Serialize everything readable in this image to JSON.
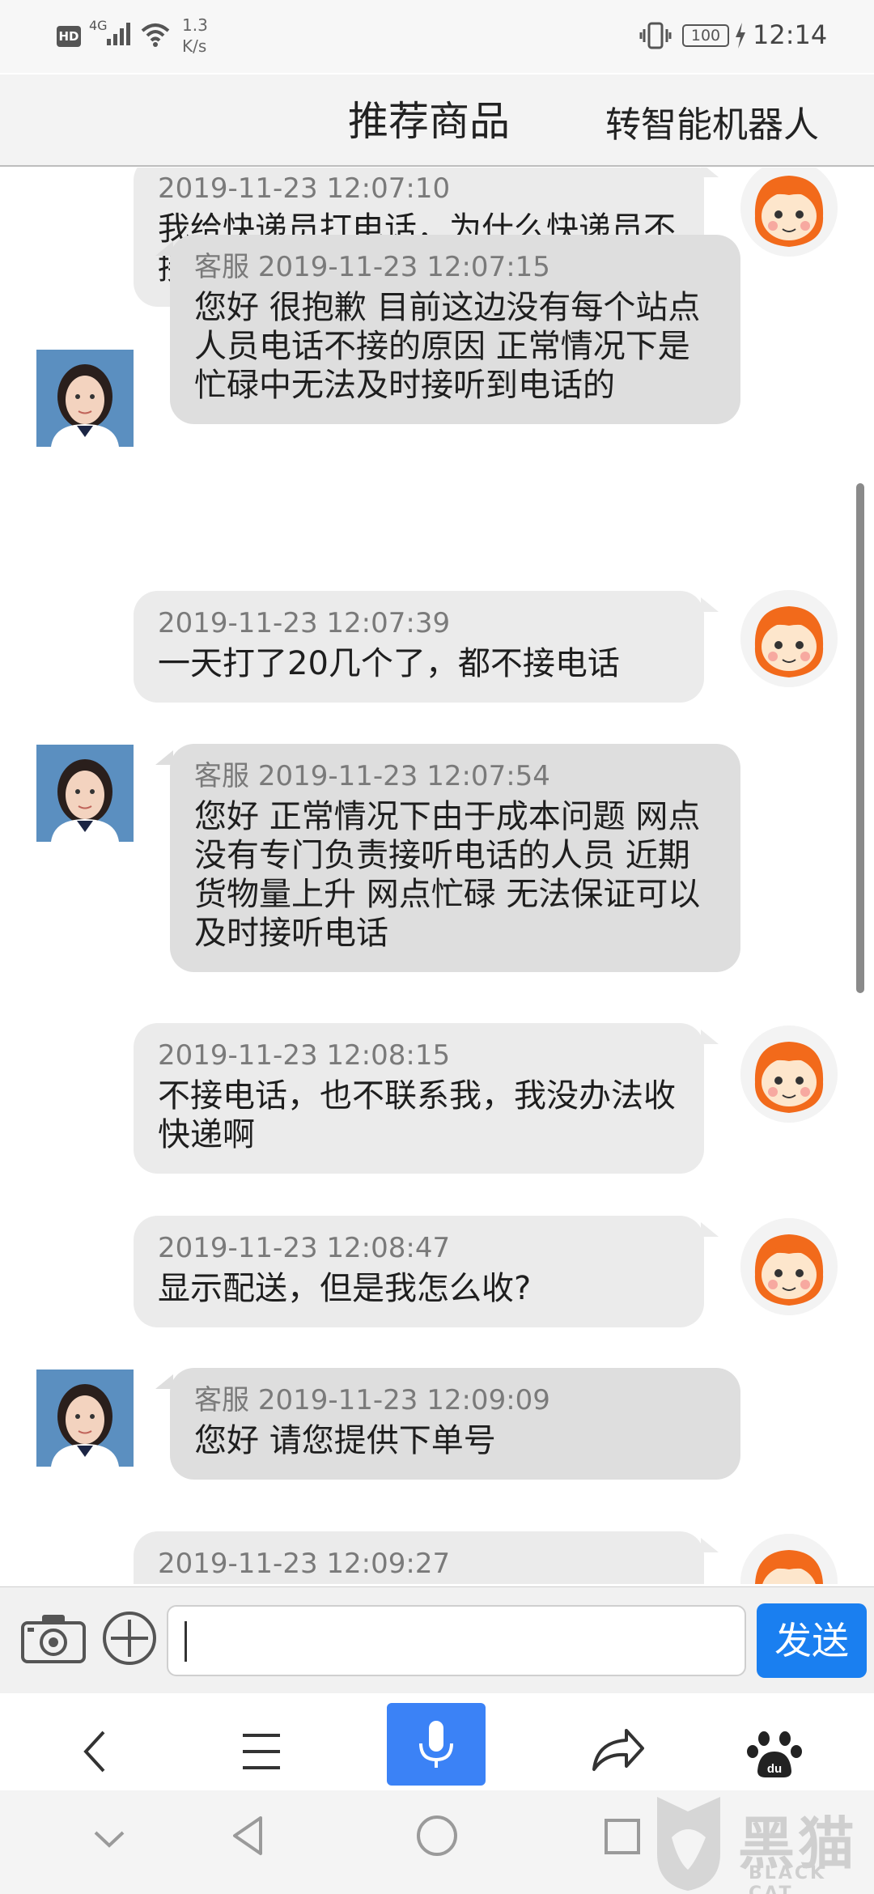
{
  "status_bar": {
    "hd": "HD",
    "network": "4G",
    "speed_value": "1.3",
    "speed_unit": "K/s",
    "battery": "100",
    "time": "12:14"
  },
  "header": {
    "title": "推荐商品",
    "action": "转智能机器人"
  },
  "messages": [
    {
      "sender": "user",
      "time": "2019-11-23 12:07:10",
      "text": "我给快递员打电话，为什么快递员不接电话"
    },
    {
      "sender": "agent",
      "label": "客服",
      "time": "2019-11-23 12:07:15",
      "text": "您好 很抱歉 目前这边没有每个站点人员电话不接的原因 正常情况下是忙碌中无法及时接听到电话的"
    },
    {
      "sender": "user",
      "time": "2019-11-23 12:07:39",
      "text": "一天打了20几个了，都不接电话"
    },
    {
      "sender": "agent",
      "label": "客服",
      "time": "2019-11-23 12:07:54",
      "text": "您好 正常情况下由于成本问题 网点没有专门负责接听电话的人员 近期货物量上升 网点忙碌 无法保证可以及时接听电话"
    },
    {
      "sender": "user",
      "time": "2019-11-23 12:08:15",
      "text": "不接电话，也不联系我，我没办法收快递啊"
    },
    {
      "sender": "user",
      "time": "2019-11-23 12:08:47",
      "text": "显示配送，但是我怎么收?"
    },
    {
      "sender": "agent",
      "label": "客服",
      "time": "2019-11-23 12:09:09",
      "text": "您好 请您提供下单号"
    },
    {
      "sender": "user",
      "time": "2019-11-23 12:09:27",
      "text": ""
    }
  ],
  "input_bar": {
    "value": "",
    "send_label": "发送"
  },
  "watermark": {
    "brand": "黑猫",
    "sub": "BLACK CAT"
  },
  "icons": {
    "camera": "camera-icon",
    "add": "plus-circle-icon",
    "back": "chevron-left-icon",
    "menu": "menu-icon",
    "mic": "microphone-icon",
    "share": "share-icon",
    "baidu": "baidu-paw-icon"
  }
}
